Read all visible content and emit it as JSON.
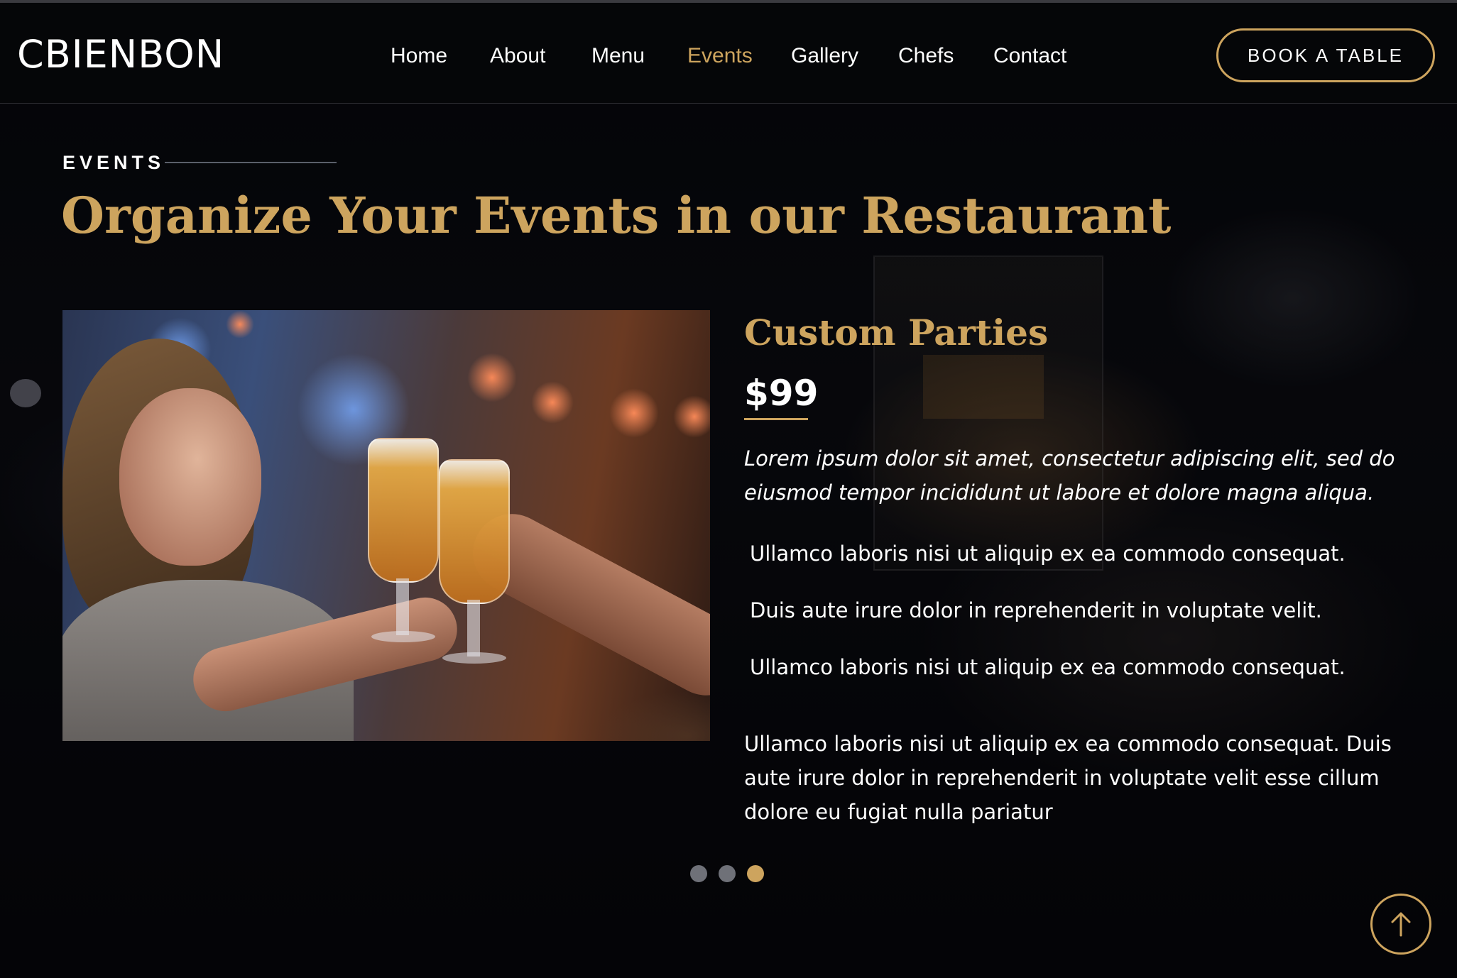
{
  "brand": {
    "logo": "CBIENBON",
    "accent_color": "#cda45e"
  },
  "nav": {
    "items": [
      {
        "label": "Home",
        "active": false
      },
      {
        "label": "About",
        "active": false
      },
      {
        "label": "Menu",
        "active": false
      },
      {
        "label": "Events",
        "active": true
      },
      {
        "label": "Gallery",
        "active": false
      },
      {
        "label": "Chefs",
        "active": false
      },
      {
        "label": "Contact",
        "active": false
      }
    ],
    "cta_label": "BOOK A TABLE"
  },
  "section": {
    "label": "EVENTS",
    "title": "Organize Your Events in our Restaurant"
  },
  "event": {
    "image_icon": "party-photo",
    "name": "Custom Parties",
    "price": "$99",
    "intro": "Lorem ipsum dolor sit amet, consectetur adipiscing elit, sed do eiusmod tempor incididunt ut labore et dolore magna aliqua.",
    "list": [
      "Ullamco laboris nisi ut aliquip ex ea commodo consequat.",
      "Duis aute irure dolor in reprehenderit in voluptate velit.",
      "Ullamco laboris nisi ut aliquip ex ea commodo consequat."
    ],
    "outro": "Ullamco laboris nisi ut aliquip ex ea commodo consequat. Duis aute irure dolor in reprehenderit in voluptate velit esse cillum dolore eu fugiat nulla pariatur"
  },
  "slider": {
    "total": 3,
    "active_index": 2
  },
  "scroll_top": {
    "icon": "arrow-up-icon"
  }
}
